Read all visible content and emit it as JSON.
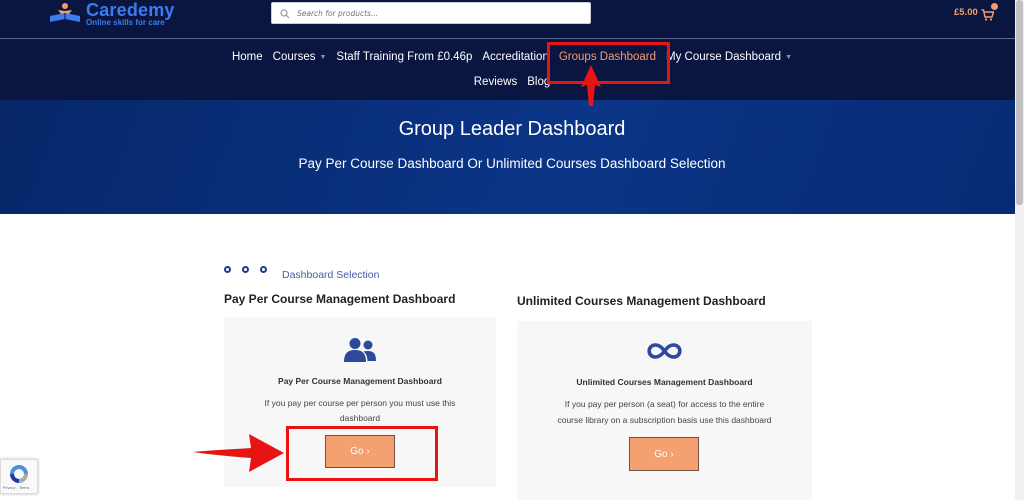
{
  "brand": {
    "name": "Caredemy",
    "tagline": "Online skills for care"
  },
  "search": {
    "placeholder": "Search for products..."
  },
  "cart": {
    "price": "£5.00"
  },
  "nav": {
    "row1": [
      {
        "label": "Home",
        "has_dropdown": false,
        "active": false
      },
      {
        "label": "Courses",
        "has_dropdown": true,
        "active": false
      },
      {
        "label": "Staff Training From £0.46p",
        "has_dropdown": false,
        "active": false
      },
      {
        "label": "Accreditation",
        "has_dropdown": false,
        "active": false
      },
      {
        "label": "Groups Dashboard",
        "has_dropdown": false,
        "active": true
      },
      {
        "label": "My Course Dashboard",
        "has_dropdown": true,
        "active": false
      }
    ],
    "row2": [
      {
        "label": "Reviews"
      },
      {
        "label": "Blog"
      }
    ]
  },
  "hero": {
    "title": "Group Leader Dashboard",
    "subtitle": "Pay Per Course Dashboard Or Unlimited Courses Dashboard Selection"
  },
  "selection": {
    "eyebrow": "Dashboard Selection",
    "left": {
      "title": "Pay Per Course Management Dashboard",
      "card_title": "Pay Per Course Management Dashboard",
      "line1": "If you pay per course per person you must use this",
      "line2": "dashboard",
      "button": "Go ›",
      "icon": "users-icon"
    },
    "right": {
      "title": "Unlimited Courses Management Dashboard",
      "card_title": "Unlimited Courses Management Dashboard",
      "line1": "If you pay per person (a seat) for access to the entire",
      "line2": "course library on a subscription basis use this dashboard",
      "button": "Go ›",
      "icon": "infinity-icon"
    }
  },
  "recaptcha": {
    "label": "Privacy - Terms"
  },
  "colors": {
    "header_bg": "#0a1640",
    "hero_bg": "#0b3587",
    "accent": "#f39c6b",
    "button": "#f5a071",
    "highlight": "#e81414",
    "icon_blue": "#2d4a9a"
  }
}
